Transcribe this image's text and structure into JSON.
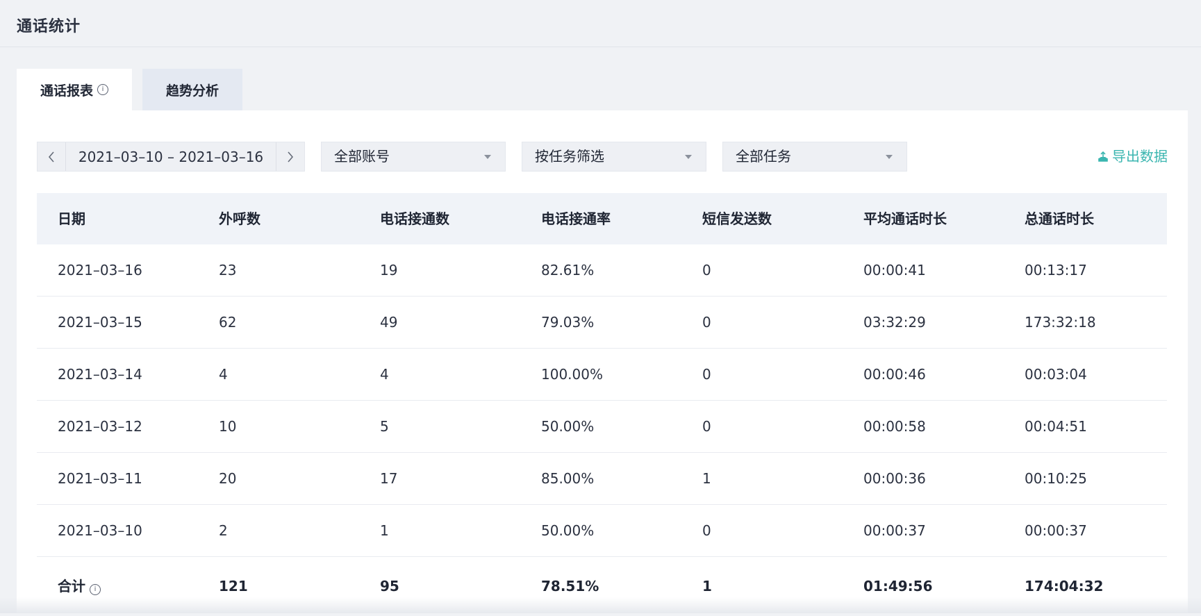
{
  "page": {
    "title": "通话统计"
  },
  "tabs": [
    {
      "label": "通话报表",
      "has_info_icon": true,
      "active": true
    },
    {
      "label": "趋势分析",
      "active": false
    }
  ],
  "filters": {
    "date_range": "2021–03–10 – 2021–03–16",
    "account_select": "全部账号",
    "filter_mode_select": "按任务筛选",
    "task_select": "全部任务",
    "export_label": "导出数据"
  },
  "table": {
    "headers": [
      "日期",
      "外呼数",
      "电话接通数",
      "电话接通率",
      "短信发送数",
      "平均通话时长",
      "总通话时长"
    ],
    "rows": [
      [
        "2021–03–16",
        "23",
        "19",
        "82.61%",
        "0",
        "00:00:41",
        "00:13:17"
      ],
      [
        "2021–03–15",
        "62",
        "49",
        "79.03%",
        "0",
        "03:32:29",
        "173:32:18"
      ],
      [
        "2021–03–14",
        "4",
        "4",
        "100.00%",
        "0",
        "00:00:46",
        "00:03:04"
      ],
      [
        "2021–03–12",
        "10",
        "5",
        "50.00%",
        "0",
        "00:00:58",
        "00:04:51"
      ],
      [
        "2021–03–11",
        "20",
        "17",
        "85.00%",
        "1",
        "00:00:36",
        "00:10:25"
      ],
      [
        "2021–03–10",
        "2",
        "1",
        "50.00%",
        "0",
        "00:00:37",
        "00:00:37"
      ]
    ],
    "total": [
      "合计",
      "121",
      "95",
      "78.51%",
      "1",
      "01:49:56",
      "174:04:32"
    ]
  },
  "colors": {
    "accent": "#3bb6b0",
    "background": "#f0f2f5",
    "header_row": "#f0f3f8"
  }
}
